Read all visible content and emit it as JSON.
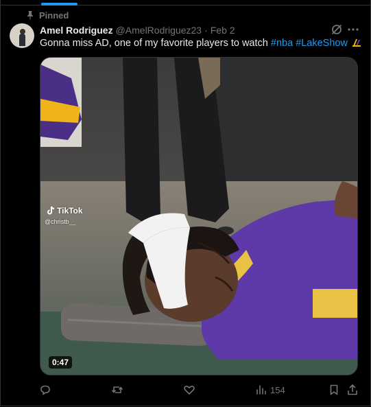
{
  "pinned": {
    "label": "Pinned",
    "icon": "pin-icon"
  },
  "author": {
    "display_name": "Amel Rodriguez",
    "handle": "@AmelRodriguez23",
    "separator": "·",
    "date": "Feb 2"
  },
  "tweet": {
    "text_plain": "Gonna miss AD, one of my favorite players to watch",
    "hashtags": [
      "#nba",
      "#LakeShow"
    ],
    "emoji": "lakers-emoji"
  },
  "media": {
    "watermark_brand": "TikTok",
    "watermark_user": "@christb__",
    "duration": "0:47"
  },
  "actions": {
    "reply_count": "",
    "repost_count": "",
    "like_count": "",
    "views_count": "154"
  },
  "colors": {
    "background": "#000000",
    "text_primary": "#e7e9ea",
    "text_secondary": "#71767b",
    "accent": "#1d9bf0",
    "border": "#2f3336"
  }
}
